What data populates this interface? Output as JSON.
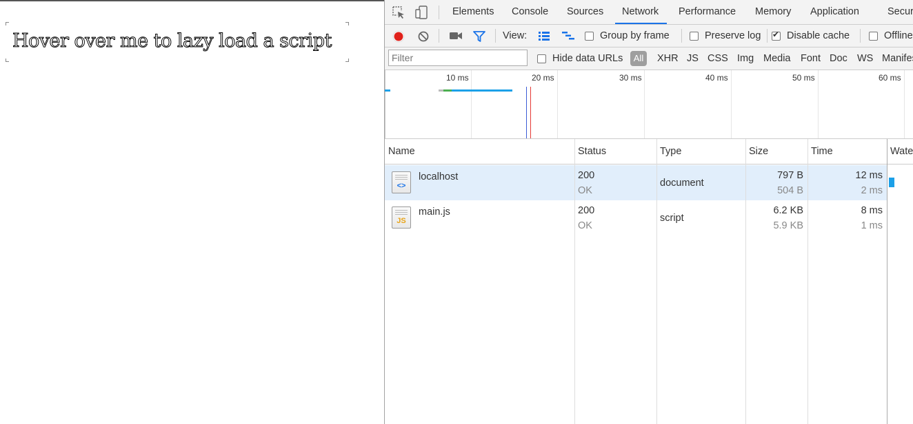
{
  "page": {
    "hover_text": "Hover over me to lazy load a script"
  },
  "devtools": {
    "tabs": [
      "Elements",
      "Console",
      "Sources",
      "Network",
      "Performance",
      "Memory",
      "Application",
      "Security"
    ],
    "active_tab": "Network",
    "toolbar": {
      "view_label": "View:",
      "group_by_frame": {
        "label": "Group by frame",
        "checked": false
      },
      "preserve_log": {
        "label": "Preserve log",
        "checked": false
      },
      "disable_cache": {
        "label": "Disable cache",
        "checked": true
      },
      "offline": {
        "label": "Offline",
        "checked": false
      },
      "record_color": "#e0211b",
      "filter_icon_color": "#1a73e8"
    },
    "filterbar": {
      "filter_placeholder": "Filter",
      "hide_data_urls": {
        "label": "Hide data URLs",
        "checked": false
      },
      "types": [
        "All",
        "XHR",
        "JS",
        "CSS",
        "Img",
        "Media",
        "Font",
        "Doc",
        "WS",
        "Manifest"
      ]
    },
    "overview": {
      "ticks": [
        "10 ms",
        "20 ms",
        "30 ms",
        "40 ms",
        "50 ms",
        "60 ms"
      ]
    },
    "table": {
      "columns": [
        "Name",
        "Status",
        "Type",
        "Size",
        "Time",
        "Waterfall"
      ],
      "rows": [
        {
          "name": "localhost",
          "icon": "document-icon",
          "status": "200",
          "status_text": "OK",
          "type": "document",
          "size": "797 B",
          "size_resource": "504 B",
          "time": "12 ms",
          "latency": "2 ms"
        },
        {
          "name": "main.js",
          "icon": "script-icon",
          "status": "200",
          "status_text": "OK",
          "type": "script",
          "size": "6.2 KB",
          "size_resource": "5.9 KB",
          "time": "8 ms",
          "latency": "1 ms"
        }
      ]
    }
  }
}
